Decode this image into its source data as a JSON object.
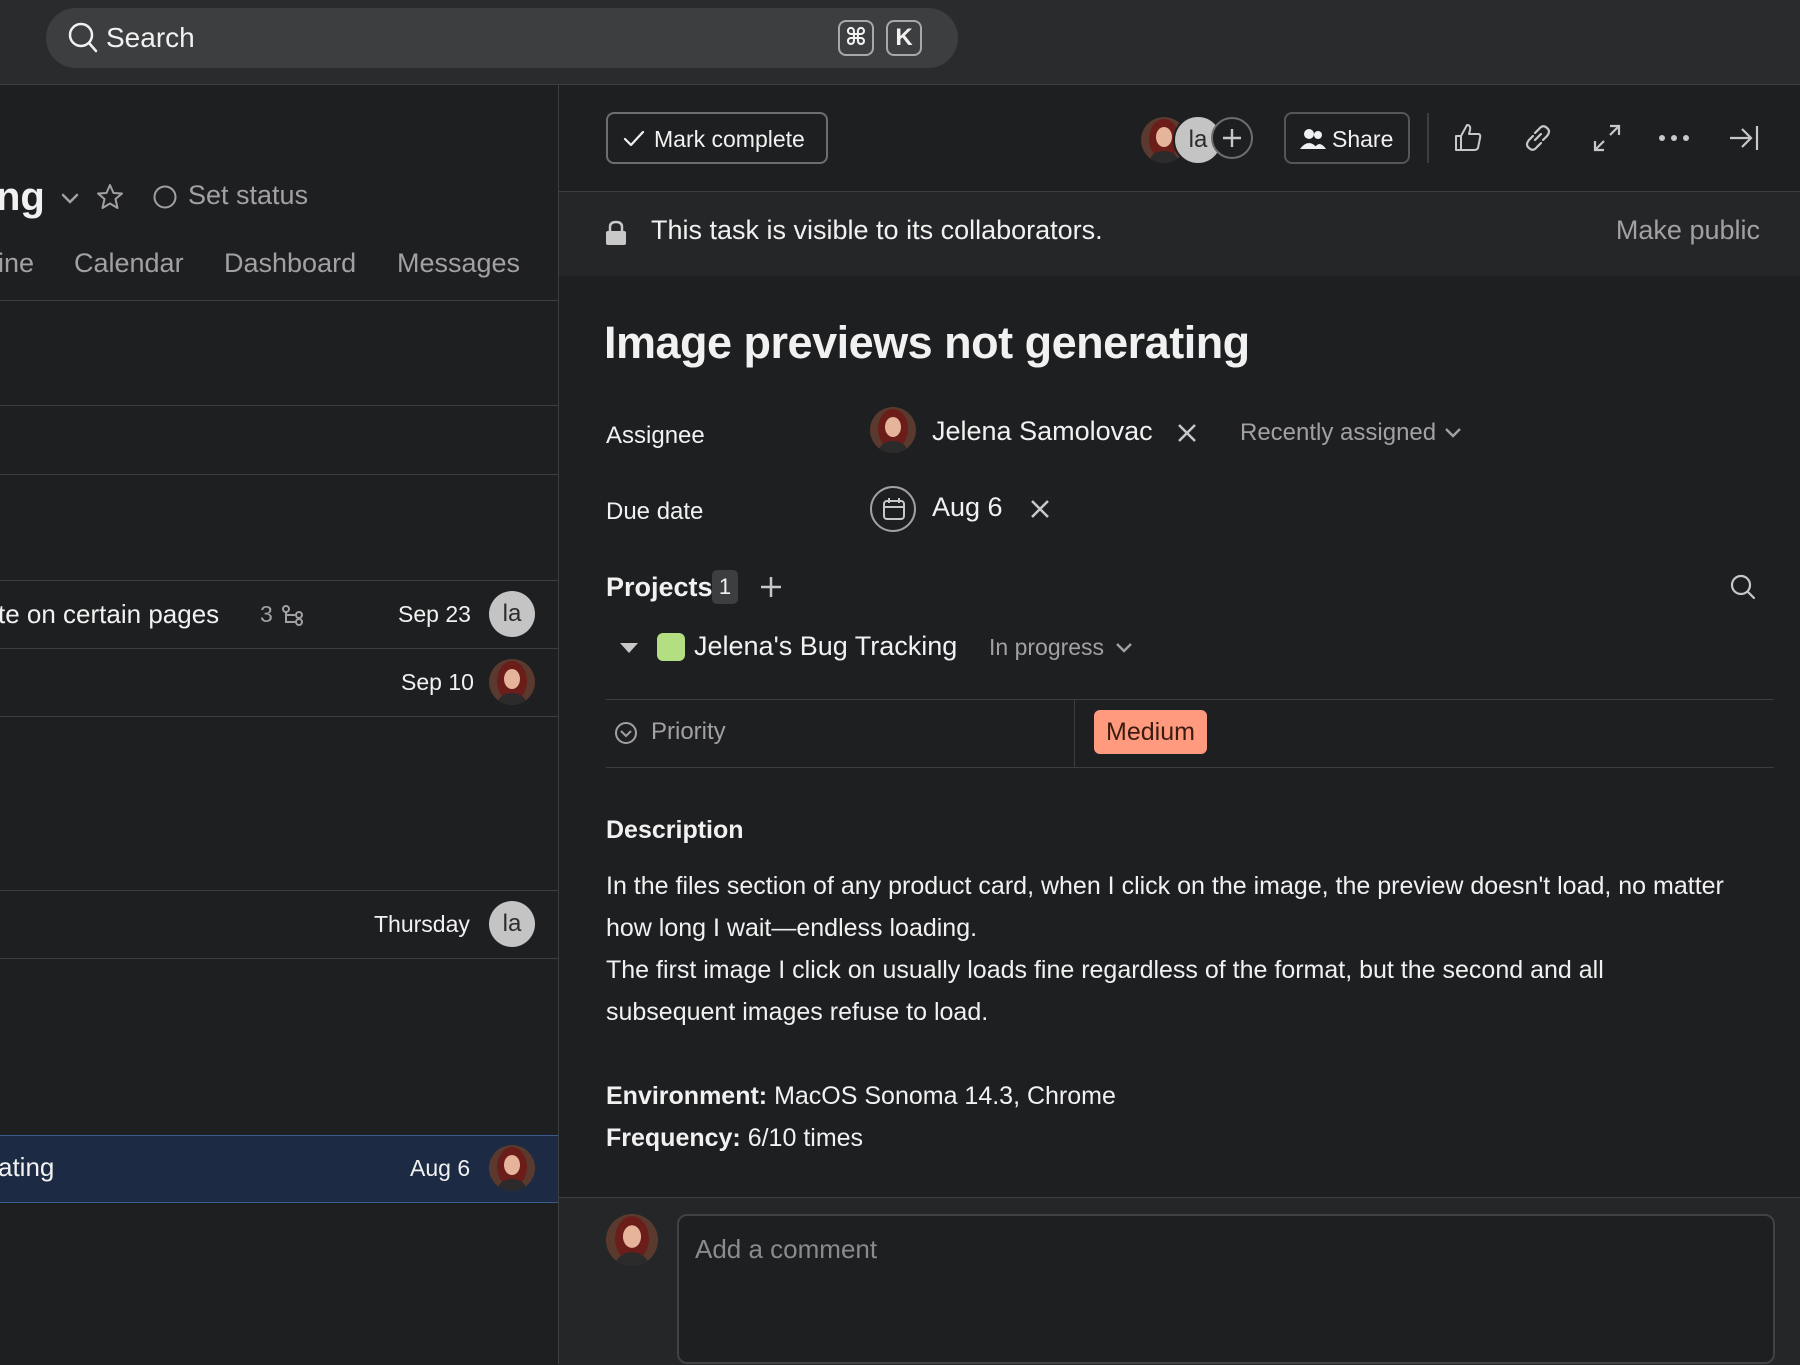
{
  "search": {
    "label": "Search",
    "shortcut": [
      "⌘",
      "K"
    ]
  },
  "project": {
    "title_fragment": "ng",
    "set_status": "Set status",
    "tabs": [
      "ine",
      "Calendar",
      "Dashboard",
      "Messages"
    ]
  },
  "task_rows": [
    {
      "title": "te on certain pages",
      "subtask_count": "3",
      "date": "Sep 23",
      "assignee_initials": "la"
    },
    {
      "title": "",
      "date": "Sep 10"
    },
    {
      "title": "",
      "date": "Thursday",
      "assignee_initials": "la"
    },
    {
      "title": "ating",
      "date": "Aug 6"
    }
  ],
  "task": {
    "mark_complete": "Mark complete",
    "collaborator_initials": "la",
    "share": "Share",
    "visibility_text": "This task is visible to its collaborators.",
    "make_public": "Make public",
    "title": "Image previews not generating",
    "assignee_label": "Assignee",
    "assignee_name": "Jelena Samolovac",
    "recently_assigned": "Recently assigned",
    "due_date_label": "Due date",
    "due_date": "Aug 6",
    "projects_label": "Projects",
    "projects_count": "1",
    "project_name": "Jelena's Bug Tracking",
    "project_status": "In progress",
    "priority_label": "Priority",
    "priority_value": "Medium",
    "description_heading": "Description",
    "description_line1": "In the files section of any product card, when I click on the image, the preview doesn't load, no matter how long I wait—endless loading.",
    "description_line2": "The first image I click on usually loads fine regardless of the format, but the second and all subsequent images refuse to load.",
    "env_label": "Environment:",
    "env_value": " MacOS Sonoma 14.3, Chrome",
    "freq_label": "Frequency:",
    "freq_value": " 6/10 times",
    "comment_placeholder": "Add a comment"
  },
  "colors": {
    "background": "#1e1f21",
    "priority_medium": "#ff9a7e",
    "project_green": "#b3df82",
    "selected_row": "#1c2a44"
  }
}
